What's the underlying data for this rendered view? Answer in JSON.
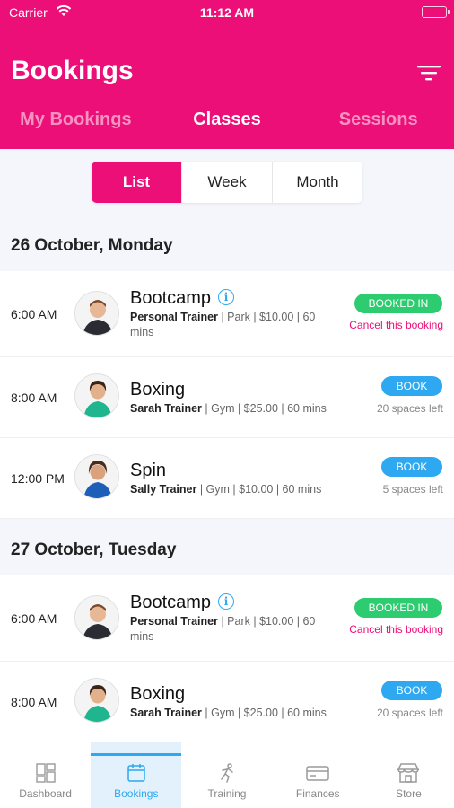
{
  "status_bar": {
    "carrier": "Carrier",
    "time": "11:12 AM"
  },
  "header": {
    "title": "Bookings"
  },
  "top_tabs": [
    "My Bookings",
    "Classes",
    "Sessions"
  ],
  "view_toggle": [
    "List",
    "Week",
    "Month"
  ],
  "days": [
    {
      "date": "26 October, Monday",
      "classes": [
        {
          "time": "6:00 AM",
          "name": "Bootcamp",
          "trainer": "Personal Trainer",
          "details": " | Park | $10.00 | 60 mins",
          "status": "BOOKED IN",
          "note": "Cancel this booking"
        },
        {
          "time": "8:00 AM",
          "name": "Boxing",
          "trainer": "Sarah Trainer",
          "details": " | Gym | $25.00 | 60 mins",
          "status": "BOOK",
          "note": "20 spaces left"
        },
        {
          "time": "12:00 PM",
          "name": "Spin",
          "trainer": "Sally Trainer",
          "details": " | Gym | $10.00 | 60 mins",
          "status": "BOOK",
          "note": "5 spaces left"
        }
      ]
    },
    {
      "date": "27 October, Tuesday",
      "classes": [
        {
          "time": "6:00 AM",
          "name": "Bootcamp",
          "trainer": "Personal Trainer",
          "details": " | Park | $10.00 | 60 mins",
          "status": "BOOKED IN",
          "note": "Cancel this booking"
        },
        {
          "time": "8:00 AM",
          "name": "Boxing",
          "trainer": "Sarah Trainer",
          "details": " | Gym | $25.00 | 60 mins",
          "status": "BOOK",
          "note": "20 spaces left"
        }
      ]
    }
  ],
  "bottom_nav": [
    "Dashboard",
    "Bookings",
    "Training",
    "Finances",
    "Store"
  ],
  "colors": {
    "brand": "#ec0f78",
    "booked": "#2ecc71",
    "book": "#2ea8f0"
  },
  "icons": [
    "wifi-icon",
    "battery-icon",
    "filter-icon",
    "info-icon",
    "dashboard-icon",
    "calendar-icon",
    "running-icon",
    "card-icon",
    "store-icon"
  ]
}
